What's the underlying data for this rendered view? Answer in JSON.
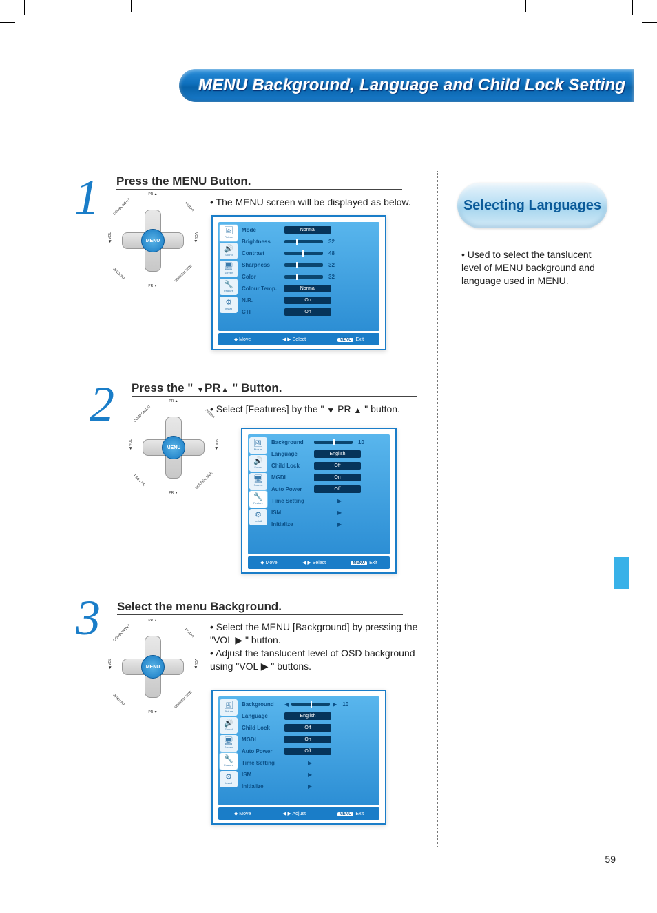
{
  "title": "MENU Background, Language and Child Lock Setting",
  "page_number": "59",
  "side": {
    "heading": "Selecting Languages",
    "text": "• Used to select the tanslucent level of MENU background and language used in MENU."
  },
  "remote": {
    "center": "MENU",
    "top": "PR ▲",
    "bottom": "PR ▼",
    "tl": "COMPONENT",
    "tr": "PC/DVI",
    "bl": "PREV.PR",
    "br": "SCREEN SIZE",
    "ml": "◀ VOL",
    "mr": "VOL ▶"
  },
  "steps": {
    "s1": {
      "num": "1",
      "head": "Press the MENU Button.",
      "bullet": "• The MENU screen will be displayed as below."
    },
    "s2": {
      "num": "2",
      "head_a": "Press the \"  ",
      "head_mid": "PR",
      "head_b": "  \" Button.",
      "bullet_a": "• Select [Features] by the \" ",
      "bullet_mid": " PR ",
      "bullet_b": " \" button."
    },
    "s3": {
      "num": "3",
      "head": "Select the menu Background.",
      "bullet_a": "• Select the MENU [Background] by pressing the \"VOL ▶ \" button.",
      "bullet_b": "• Adjust the tanslucent level of OSD background using \"VOL ▶ \" buttons."
    }
  },
  "osd_common": {
    "sidebar": [
      "Picture",
      "Sound",
      "Screen",
      "Feature",
      "Install"
    ],
    "footer_move": "Move",
    "footer_select": "Select",
    "footer_adjust": "Adjust",
    "footer_exit": "Exit",
    "footer_menu": "MENU",
    "arrow_ud": "◆",
    "arrow_lr": "◀ ▶"
  },
  "osd1": {
    "rows": [
      {
        "label": "Mode",
        "type": "box",
        "value": "Normal"
      },
      {
        "label": "Brightness",
        "type": "slider",
        "num": "32",
        "pos": "30%"
      },
      {
        "label": "Contrast",
        "type": "slider",
        "num": "48",
        "pos": "46%"
      },
      {
        "label": "Sharpness",
        "type": "slider",
        "num": "32",
        "pos": "30%"
      },
      {
        "label": "Color",
        "type": "slider",
        "num": "32",
        "pos": "30%"
      },
      {
        "label": "Colour Temp.",
        "type": "box",
        "value": "Normal"
      },
      {
        "label": "N.R.",
        "type": "box",
        "value": "On"
      },
      {
        "label": "CTI",
        "type": "box",
        "value": "On"
      }
    ]
  },
  "osd2": {
    "rows": [
      {
        "label": "Background",
        "type": "slider",
        "num": "10",
        "pos": "50%"
      },
      {
        "label": "Language",
        "type": "box",
        "value": "English"
      },
      {
        "label": "Child Lock",
        "type": "box",
        "value": "Off"
      },
      {
        "label": "MGDI",
        "type": "box",
        "value": "On"
      },
      {
        "label": "Auto Power",
        "type": "box",
        "value": "Off"
      },
      {
        "label": "Time Setting",
        "type": "arrow"
      },
      {
        "label": "ISM",
        "type": "arrow"
      },
      {
        "label": "Initialize",
        "type": "arrow"
      }
    ]
  },
  "osd3": {
    "rows": [
      {
        "label": "Background",
        "type": "slider-lr",
        "num": "10",
        "pos": "50%"
      },
      {
        "label": "Language",
        "type": "box",
        "value": "English"
      },
      {
        "label": "Child Lock",
        "type": "box",
        "value": "Off"
      },
      {
        "label": "MGDI",
        "type": "box",
        "value": "On"
      },
      {
        "label": "Auto Power",
        "type": "box",
        "value": "Off"
      },
      {
        "label": "Time Setting",
        "type": "arrow"
      },
      {
        "label": "ISM",
        "type": "arrow"
      },
      {
        "label": "Initialize",
        "type": "arrow"
      }
    ]
  }
}
